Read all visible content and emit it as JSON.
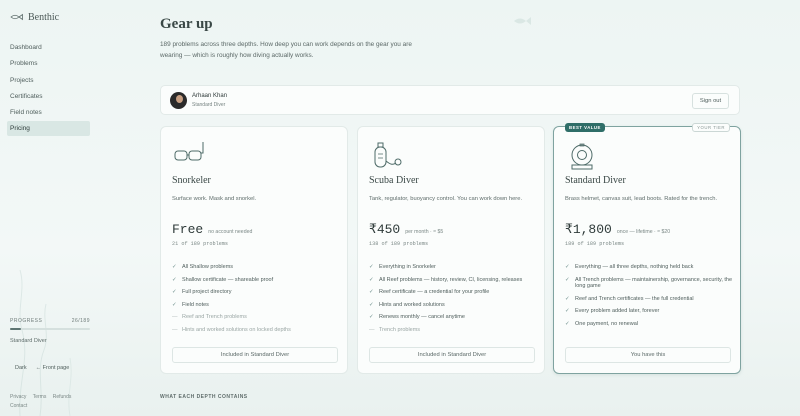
{
  "app": {
    "name": "Benthic"
  },
  "sidebar": {
    "items": [
      {
        "label": "Dashboard"
      },
      {
        "label": "Problems"
      },
      {
        "label": "Projects"
      },
      {
        "label": "Certificates"
      },
      {
        "label": "Field notes"
      },
      {
        "label": "Pricing",
        "active": true
      }
    ],
    "progress": {
      "label": "PROGRESS",
      "value_text": "26/189",
      "fraction": 0.14
    },
    "tier": "Standard Diver",
    "dark_label": "Dark",
    "front_page_label": "← Front page",
    "footer_links": [
      "Privacy",
      "Terms",
      "Refunds",
      "Contact"
    ]
  },
  "page": {
    "title": "Gear up",
    "subtitle": "189 problems across three depths. How deep you can work depends on the gear you are wearing — which is roughly how diving actually works."
  },
  "user": {
    "name": "Arhaan Khan",
    "tier": "Standard Diver",
    "signout_label": "Sign out"
  },
  "plans": [
    {
      "icon": "snorkel-mask-icon",
      "name": "Snorkeler",
      "desc": "Surface work. Mask and snorkel.",
      "price": "Free",
      "price_note": "no account needed",
      "count": "21 of 189 problems",
      "features": [
        {
          "text": "All Shallow problems",
          "included": true
        },
        {
          "text": "Shallow certificate — shareable proof",
          "included": true
        },
        {
          "text": "Full project directory",
          "included": true
        },
        {
          "text": "Field notes",
          "included": true
        },
        {
          "text": "Reef and Trench problems",
          "included": false
        },
        {
          "text": "Hints and worked solutions on locked depths",
          "included": false
        }
      ],
      "button": "Included in Standard Diver"
    },
    {
      "icon": "scuba-tank-icon",
      "name": "Scuba Diver",
      "desc": "Tank, regulator, buoyancy control. You can work down here.",
      "price": "₹450",
      "price_note": "per month · ≈ $5",
      "count": "138 of 189 problems",
      "features": [
        {
          "text": "Everything in Snorkeler",
          "included": true
        },
        {
          "text": "All Reef problems — history, review, CI, licensing, releases",
          "included": true
        },
        {
          "text": "Reef certificate — a credential for your profile",
          "included": true
        },
        {
          "text": "Hints and worked solutions",
          "included": true
        },
        {
          "text": "Renews monthly — cancel anytime",
          "included": true
        },
        {
          "text": "Trench problems",
          "included": false
        }
      ],
      "button": "Included in Standard Diver"
    },
    {
      "icon": "diving-helmet-icon",
      "name": "Standard Diver",
      "desc": "Brass helmet, canvas suit, lead boots. Rated for the trench.",
      "price": "₹1,800",
      "price_note": "once — lifetime · ≈ $20",
      "count": "189 of 189 problems",
      "badge_best": "BEST VALUE",
      "badge_tier": "YOUR TIER",
      "features": [
        {
          "text": "Everything — all three depths, nothing held back",
          "included": true
        },
        {
          "text": "All Trench problems — maintainership, governance, security, the long game",
          "included": true
        },
        {
          "text": "Reef and Trench certificates — the full credential",
          "included": true
        },
        {
          "text": "Every problem added later, forever",
          "included": true
        },
        {
          "text": "One payment, no renewal",
          "included": true
        }
      ],
      "button": "You have this"
    }
  ],
  "section": {
    "label": "WHAT EACH DEPTH CONTAINS"
  },
  "colors": {
    "accent": "#2f6e68",
    "tier_border": "#7fa3a0",
    "background": "#edf5f3"
  }
}
